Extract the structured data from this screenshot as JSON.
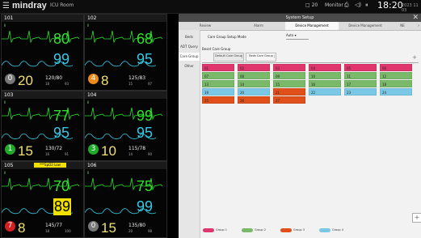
{
  "topbar": {
    "menu_icon": "hamburger-menu-icon",
    "brand": "mindray",
    "unit": "ICU Room",
    "stat1": "□ 20",
    "stat2": "Monitor",
    "clock": "18:20",
    "date": "2023 11 03"
  },
  "beds": [
    {
      "name": "101",
      "hr": "80",
      "spo2": "99",
      "resp": "20",
      "nibp": "120/80",
      "nibp_mean": "93",
      "rr": "18",
      "badge": "0",
      "badge_color": "#777",
      "alarm": ""
    },
    {
      "name": "102",
      "hr": "68",
      "spo2": "95",
      "resp": "8",
      "nibp": "125/83",
      "nibp_mean": "97",
      "rr": "15",
      "badge": "4",
      "badge_color": "#ee8a1a",
      "alarm": ""
    },
    {
      "name": "103",
      "hr": "77",
      "spo2": "95",
      "resp": "15",
      "nibp": "130/72",
      "nibp_mean": "91",
      "rr": "16",
      "badge": "1",
      "badge_color": "#1faa2a",
      "alarm": ""
    },
    {
      "name": "104",
      "hr": "99",
      "spo2": "95",
      "resp": "10",
      "nibp": "115/78",
      "nibp_mean": "90",
      "rr": "14",
      "badge": "3",
      "badge_color": "#1faa2a",
      "alarm": ""
    },
    {
      "name": "105",
      "hr": "70",
      "spo2": "89",
      "resp": "8",
      "nibp": "145/77",
      "nibp_mean": "100",
      "rr": "18",
      "badge": "7",
      "badge_color": "#d42020",
      "alarm": "***SpO2 Low"
    },
    {
      "name": "106",
      "hr": "75",
      "spo2": "99",
      "resp": "15",
      "nibp": "135/80",
      "nibp_mean": "98",
      "rr": "20",
      "badge": "0",
      "badge_color": "#777",
      "alarm": ""
    }
  ],
  "dialog": {
    "title": "System Setup",
    "tabs": [
      "Review",
      "Alarm",
      "Device Management",
      "Device Management",
      "NE"
    ],
    "active_tab": 2,
    "side_items": [
      "Beds",
      "ADT Query",
      "Care Group",
      "Other"
    ],
    "active_side": 2,
    "care_group_mode_label": "Care Group Setup Mode",
    "care_group_mode_value": "Auto",
    "sub_label": "Beset Care Group",
    "care_tabs": [
      {
        "label": "Default\nCare Group"
      },
      {
        "label": "Beds\nCare Group"
      }
    ],
    "grid": [
      [
        "01",
        "02",
        "03",
        "04",
        "05",
        "06"
      ],
      [
        "07",
        "08",
        "09",
        "10",
        "11",
        "12"
      ],
      [
        "13",
        "14",
        "15",
        "16",
        "17",
        "18"
      ],
      [
        "19",
        "20",
        "21",
        "22",
        "23",
        "24"
      ],
      [
        "25",
        "26",
        "27",
        "",
        "",
        ""
      ]
    ],
    "grid_colors": [
      [
        "#e0366e",
        "#e0366e",
        "#e0366e",
        "#e0366e",
        "#e0366e",
        "#e0366e"
      ],
      [
        "#7ab86a",
        "#7ab86a",
        "#7ab86a",
        "#7ab86a",
        "#7ab86a",
        "#7ab86a"
      ],
      [
        "#7ab86a",
        "#7ab86a",
        "#7ab86a",
        "#7ab86a",
        "#7ab86a",
        "#7ab86a"
      ],
      [
        "#7ac8e6",
        "#7ac8e6",
        "#e0501a",
        "#7ac8e6",
        "#7ac8e6",
        "#7ac8e6"
      ],
      [
        "#e0501a",
        "#e0501a",
        "#e0501a",
        "",
        "",
        ""
      ]
    ],
    "legend": [
      {
        "label": "Group 1",
        "color": "#e0366e"
      },
      {
        "label": "Group 2",
        "color": "#7ab86a"
      },
      {
        "label": "Group 3",
        "color": "#e0501a"
      },
      {
        "label": "Group 4",
        "color": "#7ac8e6"
      }
    ]
  }
}
